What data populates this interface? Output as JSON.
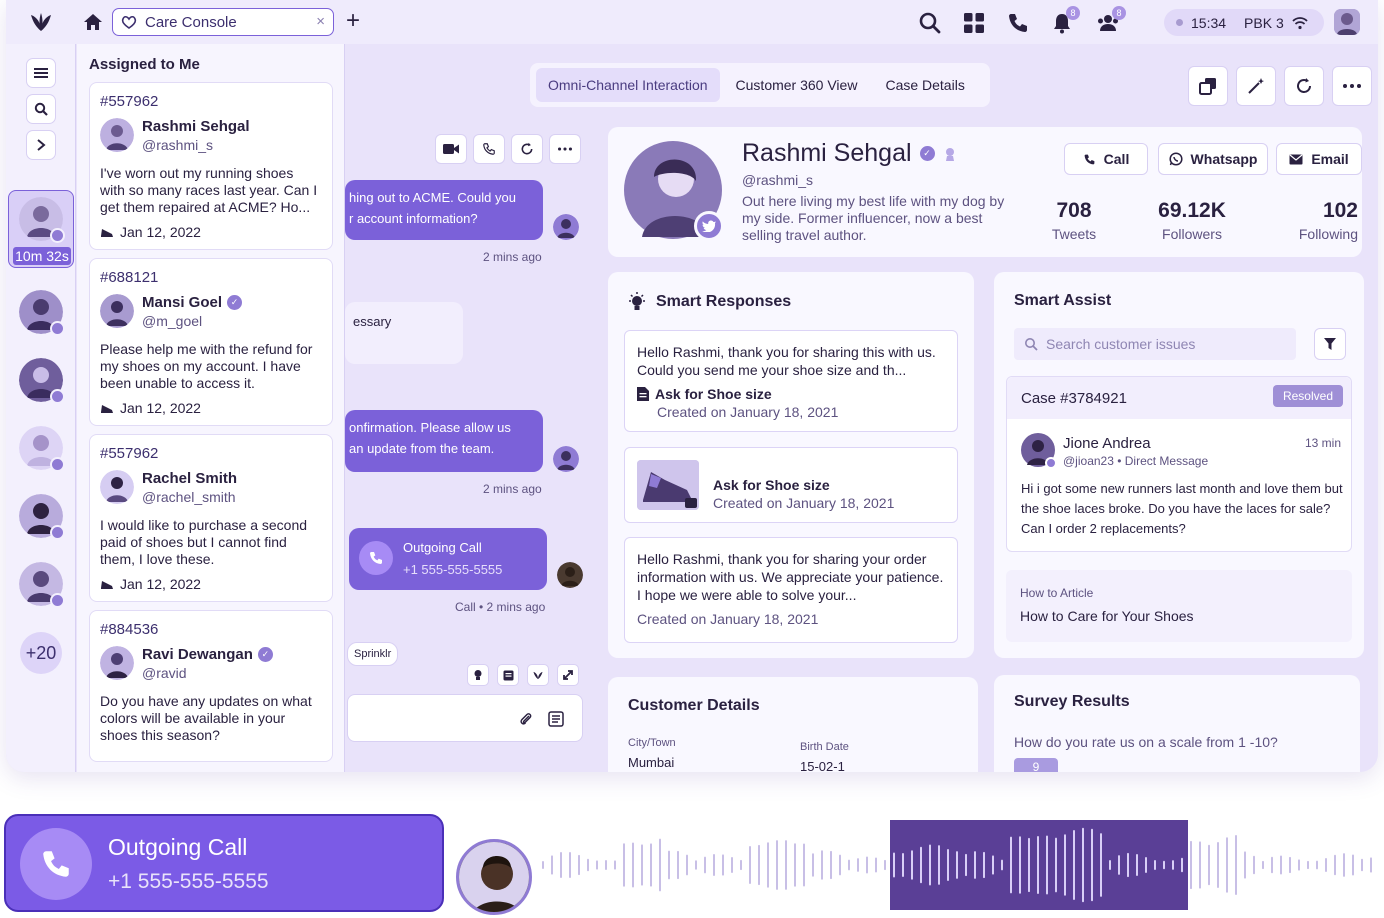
{
  "topbar": {
    "tab_label": "Care Console",
    "tab_close": "×",
    "new_tab": "+",
    "notifications_badge": "8",
    "team_badge": "8",
    "time": "15:34",
    "workspace": "PBK 3"
  },
  "rail": {
    "timer": "10m 32s",
    "more_count": "+20"
  },
  "inbox": {
    "title": "Assigned to Me",
    "cards": [
      {
        "id": "#557962",
        "name": "Rashmi Sehgal",
        "handle": "@rashmi_s",
        "message": "I've worn out my running shoes with so many races last year. Can I get them repaired at ACME? Ho...",
        "date": "Jan 12, 2022"
      },
      {
        "id": "#688121",
        "name": "Mansi Goel",
        "handle": "@m_goel",
        "message": "Please help me with the refund for my shoes on my account. I have been unable to access it.",
        "date": "Jan 12, 2022"
      },
      {
        "id": "#557962",
        "name": "Rachel Smith",
        "handle": "@rachel_smith",
        "message": "I would like to purchase a second paid of shoes but I cannot find them, I love these.",
        "date": "Jan 12, 2022"
      },
      {
        "id": "#884536",
        "name": "Ravi Dewangan",
        "handle": "@ravid",
        "message": "Do you have any updates on what colors will be available in your shoes this season?",
        "date": ""
      }
    ]
  },
  "tabs": [
    "Omni-Channel Interaction",
    "Customer 360 View",
    "Case Details"
  ],
  "chat": {
    "msg1_line1": "hing out to ACME. Could you",
    "msg1_line2": "r account information?",
    "msg1_time": "2 mins ago",
    "msg2": "essary",
    "msg3_line1": "onfirmation. Please allow us",
    "msg3_line2": "an update from the team.",
    "msg3_time": "2 mins ago",
    "call_title": "Outgoing Call",
    "call_number": "+1 555-555-5555",
    "call_meta": "Call • 2 mins ago",
    "brand_chip": "Sprinklr"
  },
  "profile": {
    "name": "Rashmi Sehgal",
    "handle": "@rashmi_s",
    "bio": "Out here living my best life with my dog by my side. Former influencer, now a best selling travel author.",
    "call_label": "Call",
    "whatsapp_label": "Whatsapp",
    "email_label": "Email",
    "tweets_value": "708",
    "tweets_label": "Tweets",
    "followers_value": "69.12K",
    "followers_label": "Followers",
    "following_value": "102",
    "following_label": "Following"
  },
  "smart_responses": {
    "title": "Smart Responses",
    "r1_text": "Hello Rashmi, thank you for sharing this with us. Could you send me your shoe size and th...",
    "r1_doc_title": "Ask for Shoe size",
    "r1_doc_date": "Created on January 18, 2021",
    "r2_title": "Ask for Shoe size",
    "r2_date": "Created on January 18, 2021",
    "r3_text": "Hello Rashmi, thank you for sharing your order information with us. We appreciate your patience. I hope we were able to solve your...",
    "r3_date": "Created on January 18, 2021"
  },
  "smart_assist": {
    "title": "Smart Assist",
    "search_placeholder": "Search customer issues",
    "case_id": "Case #3784921",
    "case_status": "Resolved",
    "author": "Jione Andrea",
    "author_meta": "@jioan23 • Direct Message",
    "time_ago": "13 min",
    "message": "Hi i got some new runners last month and love them but the shoe laces broke. Do you have the laces for sale? Can I order 2 replacements?",
    "article_label": "How to Article",
    "article_title": "How to Care for Your Shoes"
  },
  "customer_details": {
    "title": "Customer Details",
    "city_label": "City/Town",
    "city_value": "Mumbai",
    "birth_label": "Birth Date",
    "birth_value": "15-02-1"
  },
  "survey": {
    "title": "Survey Results",
    "question": "How do you rate us on a scale from 1 -10?",
    "answer": "9"
  },
  "call_banner": {
    "title": "Outgoing Call",
    "number": "+1 555-555-5555"
  },
  "colors": {
    "accent": "#7b61d9",
    "banner": "#7b5be6",
    "wave_highlight": "#5a3f96"
  }
}
